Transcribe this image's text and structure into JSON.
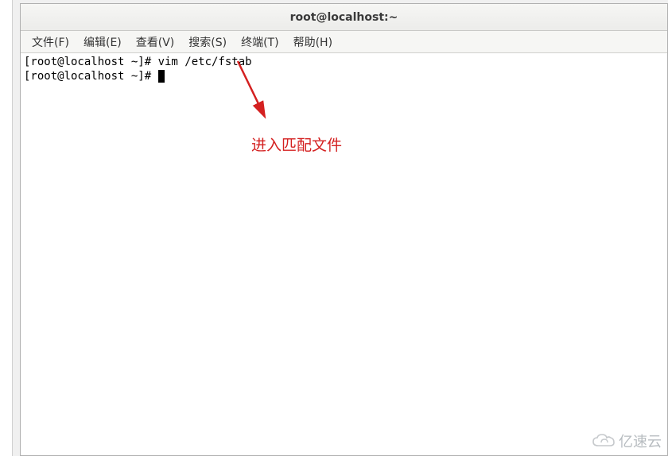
{
  "window": {
    "title": "root@localhost:~"
  },
  "menu": {
    "file": "文件(F)",
    "edit": "编辑(E)",
    "view": "查看(V)",
    "search": "搜索(S)",
    "terminal": "终端(T)",
    "help": "帮助(H)"
  },
  "terminal": {
    "line1": "[root@localhost ~]# vim /etc/fstab",
    "line2_prefix": "[root@localhost ~]# "
  },
  "annotation": {
    "text": "进入匹配文件",
    "arrow_color": "#d42020"
  },
  "watermark": {
    "text": "亿速云"
  }
}
